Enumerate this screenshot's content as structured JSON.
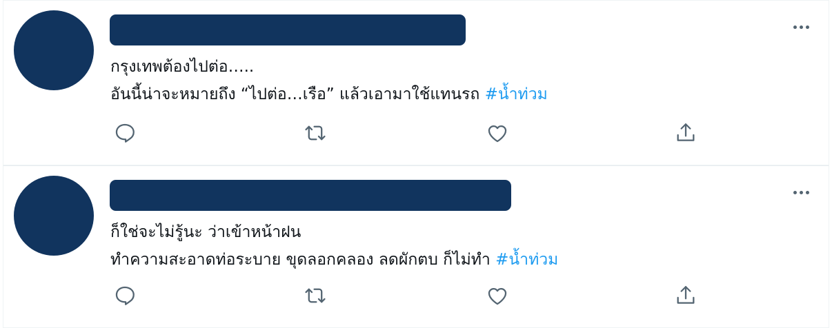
{
  "tweets": [
    {
      "lines": [
        "กรุงเทพต้องไปต่อ…..",
        "อันนี้น่าจะหมายถึง “ไปต่อ…เรือ” แล้วเอามาใช้แทนรถ"
      ],
      "hashtag": "#น้ำท่วม"
    },
    {
      "lines": [
        "ก็ใช่จะไม่รู้นะ ว่าเข้าหน้าฝน",
        "ทำความสะอาดท่อระบาย ขุดลอกคลอง ลดผักตบ ก็ไม่ทำ"
      ],
      "hashtag": "#น้ำท่วม"
    }
  ],
  "colors": {
    "avatar": "#11345e",
    "name_redaction": "#11345e",
    "hashtag": "#1d9bf0",
    "icon": "#536471"
  },
  "icons": [
    "more-icon",
    "reply-icon",
    "retweet-icon",
    "like-icon",
    "share-icon"
  ]
}
